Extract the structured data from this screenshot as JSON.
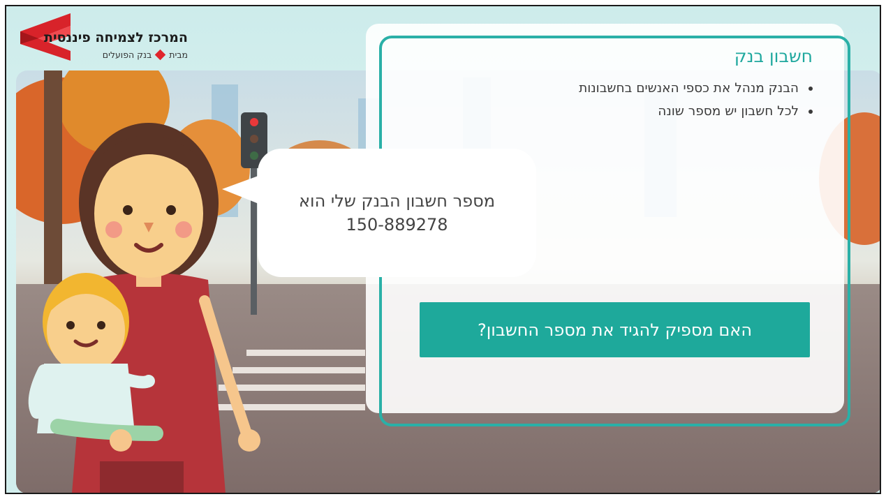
{
  "logo": {
    "title": "המרכז לצמיחה פיננסית",
    "subtitle_prefix": "מבית",
    "subtitle_brand": "בנק הפועלים",
    "accent_color": "#e0262d"
  },
  "panel": {
    "heading": "חשבון בנק",
    "bullets": [
      "הבנק מנהל את כספי האנשים בחשבונות",
      "לכל חשבון יש מספר שונה"
    ],
    "accent_color": "#1fa89e"
  },
  "speech_bubble": {
    "line1": "מספר חשבון הבנק שלי הוא",
    "line2": "150-889278"
  },
  "question_button": {
    "label": "האם מספיק להגיד את מספר החשבון?",
    "color": "#1ea99b"
  }
}
